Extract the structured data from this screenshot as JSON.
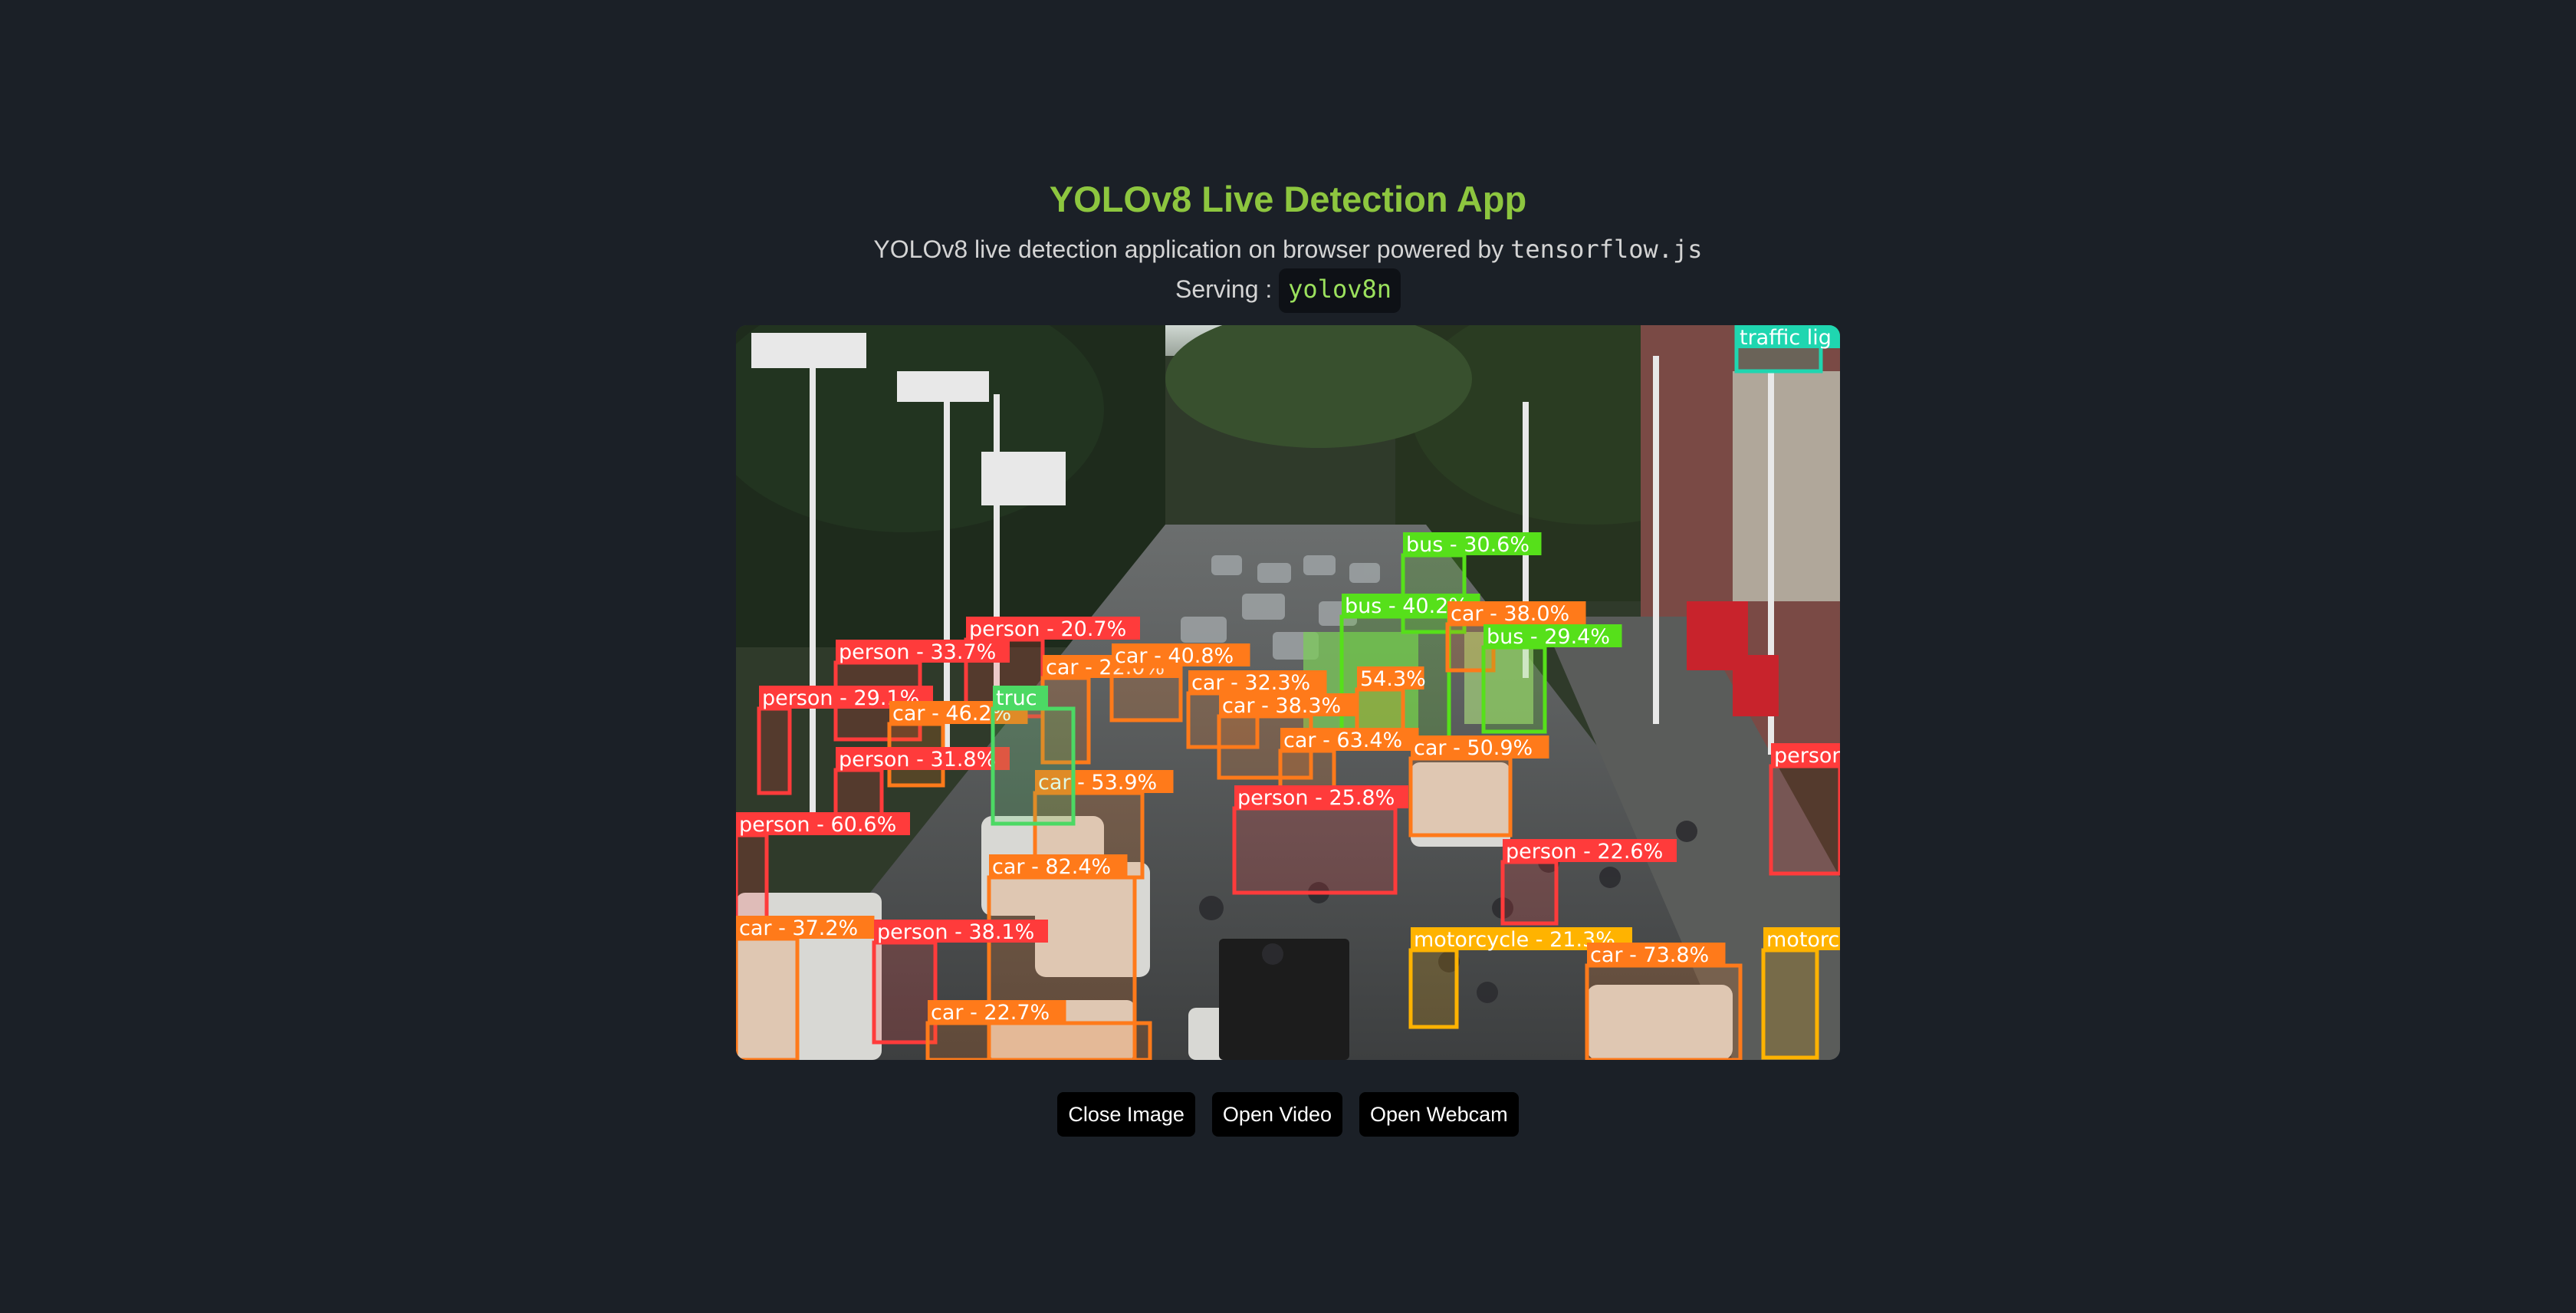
{
  "app": {
    "title": "YOLOv8 Live Detection App",
    "subtitle_text": "YOLOv8 live detection application on browser powered by",
    "subtitle_code": "tensorflow.js",
    "serving_label": "Serving :",
    "model_name": "yolov8n"
  },
  "colors": {
    "background": "#1b2027",
    "title": "#8dc63f",
    "person": "#ff3b3b",
    "car": "#ff7a1a",
    "bus": "#56e01a",
    "truck": "#4cd964",
    "motorcycle": "#ffb300",
    "traffic_light": "#1fd6b0"
  },
  "detections": [
    {
      "label": "bus - 30.6%",
      "cls": "bus"
    },
    {
      "label": "bus - 40.2%",
      "cls": "bus"
    },
    {
      "label": "car - 38.0%",
      "cls": "car"
    },
    {
      "label": "bus - 29.4%",
      "cls": "bus"
    },
    {
      "label": "person - 20.7%",
      "cls": "person"
    },
    {
      "label": "person - 33.7%",
      "cls": "person"
    },
    {
      "label": "car - 22.0%",
      "cls": "car"
    },
    {
      "label": "car - 40.8%",
      "cls": "car"
    },
    {
      "label": "car - 32.3%",
      "cls": "car"
    },
    {
      "label": "54.3%",
      "cls": "car"
    },
    {
      "label": "person - 29.1%",
      "cls": "person"
    },
    {
      "label": "car - 46.2%",
      "cls": "car"
    },
    {
      "label": "car - 38.3%",
      "cls": "car"
    },
    {
      "label": "car - 63.4%",
      "cls": "car"
    },
    {
      "label": "car - 50.9%",
      "cls": "car"
    },
    {
      "label": "person - 31.8%",
      "cls": "person"
    },
    {
      "label": "car - 53.9%",
      "cls": "car"
    },
    {
      "label": "person - 25.8%",
      "cls": "person"
    },
    {
      "label": "person - 60.6%",
      "cls": "person"
    },
    {
      "label": "person - 22.6%",
      "cls": "person"
    },
    {
      "label": "car - 82.4%",
      "cls": "car"
    },
    {
      "label": "car - 37.2%",
      "cls": "car"
    },
    {
      "label": "person - 38.1%",
      "cls": "person"
    },
    {
      "label": "motorcycle - 21.3%",
      "cls": "motorcycle"
    },
    {
      "label": "car - 73.8%",
      "cls": "car"
    },
    {
      "label": "car - 22.7%",
      "cls": "car"
    },
    {
      "label": "traffic lig",
      "cls": "traffic_light"
    },
    {
      "label": "person",
      "cls": "person"
    },
    {
      "label": "motorc",
      "cls": "motorcycle"
    },
    {
      "label": "truc",
      "cls": "truck"
    }
  ],
  "buttons": {
    "close_image": "Close Image",
    "open_video": "Open Video",
    "open_webcam": "Open Webcam"
  }
}
